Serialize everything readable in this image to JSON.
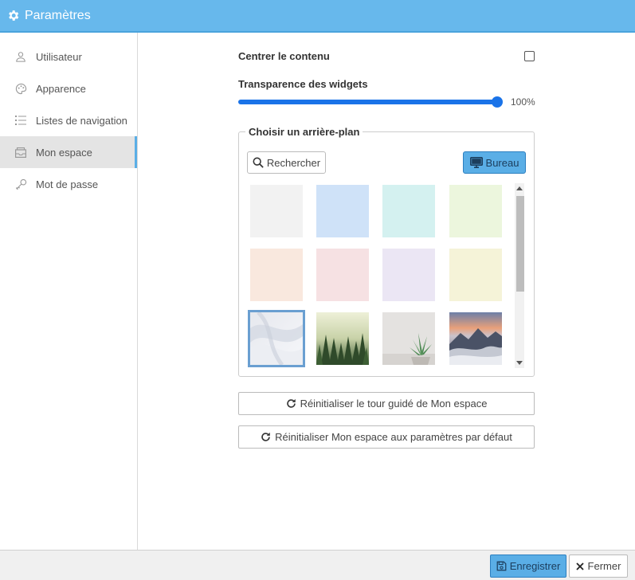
{
  "window": {
    "title": "Paramètres",
    "icon": "gear-icon"
  },
  "sidebar": {
    "items": [
      {
        "label": "Utilisateur",
        "icon": "user-icon",
        "active": false
      },
      {
        "label": "Apparence",
        "icon": "palette-icon",
        "active": false
      },
      {
        "label": "Listes de navigation",
        "icon": "list-icon",
        "active": false
      },
      {
        "label": "Mon espace",
        "icon": "inbox-icon",
        "active": true
      },
      {
        "label": "Mot de passe",
        "icon": "key-icon",
        "active": false
      }
    ]
  },
  "main": {
    "center_content": {
      "label": "Centrer le contenu",
      "checked": false
    },
    "widget_transparency": {
      "label": "Transparence des widgets",
      "value_label": "100%",
      "value": 1.0
    },
    "background_picker": {
      "legend": "Choisir un arrière-plan",
      "search_button": "Rechercher",
      "desktop_button": "Bureau",
      "tiles": [
        {
          "kind": "color",
          "color": "#f2f2f2"
        },
        {
          "kind": "color",
          "color": "#cfe2f8"
        },
        {
          "kind": "color",
          "color": "#d4f1f0"
        },
        {
          "kind": "color",
          "color": "#ecf6dd"
        },
        {
          "kind": "color",
          "color": "#f9e8de"
        },
        {
          "kind": "color",
          "color": "#f6e1e3"
        },
        {
          "kind": "color",
          "color": "#ebe6f4"
        },
        {
          "kind": "color",
          "color": "#f5f3d8"
        },
        {
          "kind": "image",
          "name": "white-abstract-image",
          "selected": true
        },
        {
          "kind": "image",
          "name": "forest-fog-image"
        },
        {
          "kind": "image",
          "name": "succulent-plant-image"
        },
        {
          "kind": "image",
          "name": "mountain-sunset-image"
        }
      ]
    },
    "reset_tour_button": "Réinitialiser le tour guidé de Mon espace",
    "reset_defaults_button": "Réinitialiser Mon espace aux paramètres par défaut"
  },
  "footer": {
    "save_label": "Enregistrer",
    "close_label": "Fermer"
  },
  "colors": {
    "accent": "#5aaee6",
    "titlebar": "#67b8ec",
    "slider": "#1a73e8"
  }
}
